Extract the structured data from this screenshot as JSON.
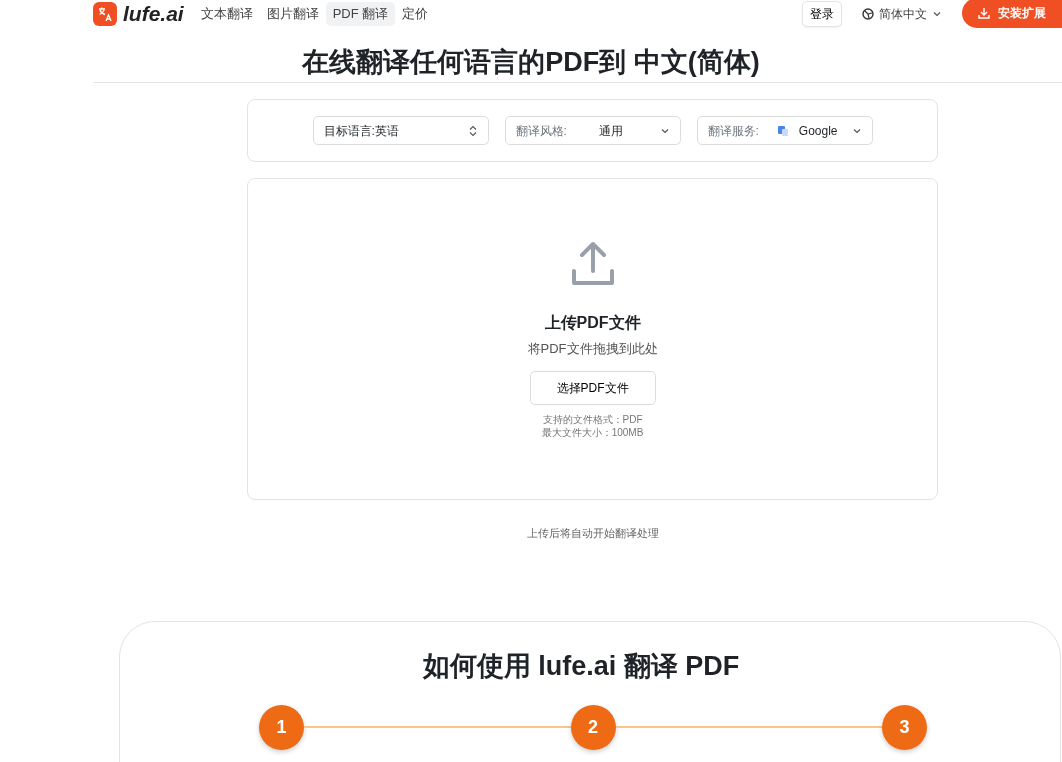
{
  "brand": {
    "name": "lufe.ai"
  },
  "nav": [
    {
      "label": "文本翻译",
      "selected": false
    },
    {
      "label": "图片翻译",
      "selected": false
    },
    {
      "label": "PDF 翻译",
      "selected": true
    },
    {
      "label": "定价",
      "selected": false
    }
  ],
  "login": "登录",
  "language": "简体中文",
  "install": "安装扩展",
  "title": "在线翻译任何语言的PDF到 中文(简体)",
  "settings": [
    {
      "kind": "updown",
      "label": "目标语言:英语"
    },
    {
      "kind": "select",
      "label": "翻译风格:",
      "value": "通用"
    },
    {
      "kind": "service",
      "label": "翻译服务:",
      "value": "Google"
    }
  ],
  "upload": {
    "title": "上传PDF文件",
    "hint": "将PDF文件拖拽到此处",
    "button": "选择PDF文件",
    "formats": "支持的文件格式：PDF",
    "max_size": "最大文件大小：100MB"
  },
  "note": "上传后将自动开始翻译处理",
  "howto": {
    "title": "如何使用 lufe.ai 翻译 PDF",
    "steps": [
      "1",
      "2",
      "3"
    ]
  }
}
